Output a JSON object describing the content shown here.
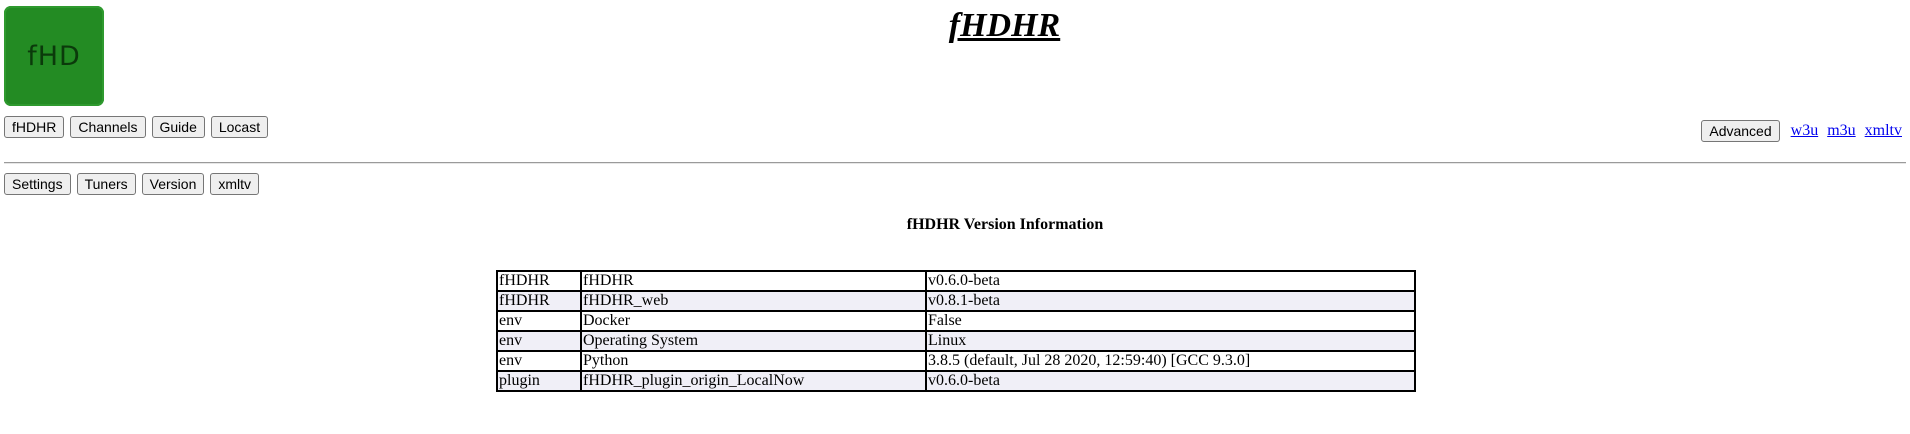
{
  "header": {
    "logo_text": "fHD",
    "title": "fHDHR"
  },
  "nav": {
    "left": [
      "fHDHR",
      "Channels",
      "Guide",
      "Locast"
    ],
    "advanced_label": "Advanced",
    "links": [
      "w3u",
      "m3u",
      "xmltv"
    ]
  },
  "subnav": {
    "items": [
      "Settings",
      "Tuners",
      "Version",
      "xmltv"
    ]
  },
  "main": {
    "heading": "fHDHR Version Information",
    "rows": [
      [
        "fHDHR",
        "fHDHR",
        "v0.6.0-beta"
      ],
      [
        "fHDHR",
        "fHDHR_web",
        "v0.8.1-beta"
      ],
      [
        "env",
        "Docker",
        "False"
      ],
      [
        "env",
        "Operating System",
        "Linux"
      ],
      [
        "env",
        "Python",
        "3.8.5 (default, Jul 28 2020, 12:59:40) [GCC 9.3.0]"
      ],
      [
        "plugin",
        "fHDHR_plugin_origin_LocalNow",
        "v0.6.0-beta"
      ]
    ]
  },
  "colors": {
    "logo_bg": "#238b23",
    "link": "#0000ee",
    "row_alt": "#f0eff7"
  }
}
